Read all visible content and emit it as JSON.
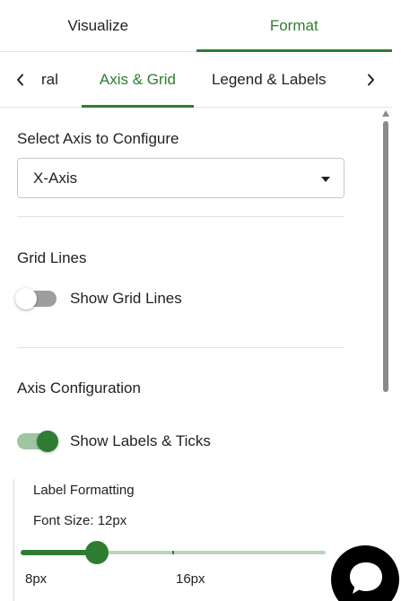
{
  "top_tabs": [
    {
      "label": "Visualize",
      "active": false
    },
    {
      "label": "Format",
      "active": true
    }
  ],
  "sub_tabs": {
    "partial_label": "ral",
    "items": [
      {
        "label": "Axis & Grid",
        "active": true
      },
      {
        "label": "Legend & Labels",
        "active": false
      }
    ],
    "left_icon": "chevron-left-icon",
    "right_icon": "chevron-right-icon"
  },
  "axis_select": {
    "label": "Select Axis to Configure",
    "value": "X-Axis"
  },
  "grid_lines": {
    "heading": "Grid Lines",
    "toggle_label": "Show Grid Lines",
    "enabled": false
  },
  "axis_config": {
    "heading": "Axis Configuration",
    "toggle_label": "Show Labels & Ticks",
    "enabled": true
  },
  "label_formatting": {
    "heading": "Label Formatting",
    "font_size_label": "Font Size: 12px",
    "slider": {
      "min": 8,
      "max": 24,
      "value": 12,
      "tick_labels": [
        "8px",
        "16px"
      ]
    }
  },
  "colors": {
    "accent": "#2e7d32",
    "accent_light": "#b9d6bb",
    "text": "#222222"
  },
  "chat_button": {
    "icon": "chat-bubble-icon"
  }
}
